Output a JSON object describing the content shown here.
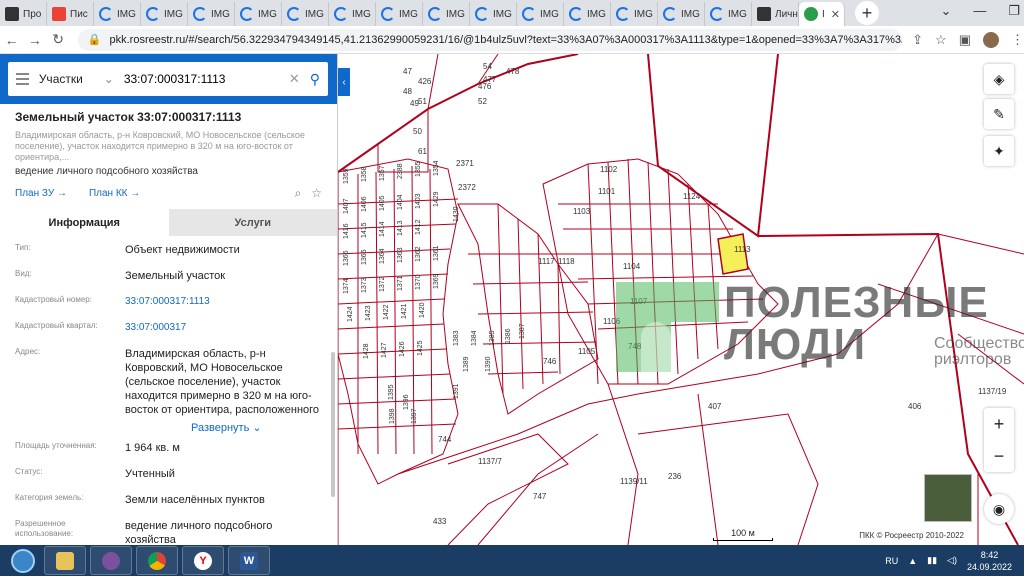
{
  "browser": {
    "tabs": [
      {
        "label": "Про",
        "icon": "page-icon"
      },
      {
        "label": "Пис",
        "icon": "gmail-icon"
      },
      {
        "label": "IMG",
        "icon": "img-icon"
      },
      {
        "label": "IMG",
        "icon": "img-icon"
      },
      {
        "label": "IMG",
        "icon": "img-icon"
      },
      {
        "label": "IMG",
        "icon": "img-icon"
      },
      {
        "label": "IMG",
        "icon": "img-icon"
      },
      {
        "label": "IMG",
        "icon": "img-icon"
      },
      {
        "label": "IMG",
        "icon": "img-icon"
      },
      {
        "label": "IMG",
        "icon": "img-icon"
      },
      {
        "label": "IMG",
        "icon": "img-icon"
      },
      {
        "label": "IMG",
        "icon": "img-icon"
      },
      {
        "label": "IMG",
        "icon": "img-icon"
      },
      {
        "label": "IMG",
        "icon": "img-icon"
      },
      {
        "label": "IMG",
        "icon": "img-icon"
      },
      {
        "label": "IMG",
        "icon": "img-icon"
      },
      {
        "label": "Личн",
        "icon": "page-icon"
      },
      {
        "label": "I",
        "icon": "rosreestr-icon",
        "active": true
      }
    ],
    "new_tab": "+",
    "url": "pkk.rosreestr.ru/#/search/56.322934794349145,41.21362990059231/16/@1b4ulz5uvl?text=33%3A07%3A000317%3A1113&type=1&opened=33%3A7%3A317%3A1113"
  },
  "search": {
    "type_label": "Участки",
    "query": "33:07:000317:1113"
  },
  "object": {
    "title": "Земельный участок 33:07:000317:1113",
    "address_short": "Владимирская область, р-н Ковровский, МО Новосельское (сельское поселение), участок находится примерно в 320 м на юго-восток от ориентира,...",
    "use": "ведение личного подсобного хозяйства",
    "plan_zu": "План ЗУ →",
    "plan_kk": "План КК →"
  },
  "panel_tabs": {
    "info": "Информация",
    "services": "Услуги"
  },
  "info_rows": [
    {
      "label": "Тип:",
      "value": "Объект недвижимости"
    },
    {
      "label": "Вид:",
      "value": "Земельный участок"
    },
    {
      "label": "Кадастровый номер:",
      "value": "33:07:000317:1113",
      "link": true
    },
    {
      "label": "Кадастровый квартал:",
      "value": "33:07:000317",
      "link": true
    },
    {
      "label": "Адрес:",
      "value": "Владимирская область, р-н Ковровский, МО Новосельское (сельское поселение), участок находится примерно в 320 м на юго-восток от ориентира, расположенного"
    },
    {
      "label": "Площадь уточненная:",
      "value": "1 964 кв. м"
    },
    {
      "label": "Статус:",
      "value": "Учтенный"
    },
    {
      "label": "Категория земель:",
      "value": "Земли населённых пунктов"
    },
    {
      "label": "Разрешенное использование:",
      "value": "ведение личного подсобного хозяйства"
    }
  ],
  "expand_label": "Развернуть ⌄",
  "map": {
    "parcels": [
      "426",
      "47",
      "48",
      "49",
      "50",
      "51",
      "52",
      "54",
      "476",
      "477",
      "478",
      "61",
      "2371",
      "2372",
      "1359",
      "1358",
      "1357",
      "2388",
      "1355",
      "1354",
      "1407",
      "1406",
      "1405",
      "1404",
      "1403",
      "1429",
      "1430",
      "1416",
      "1415",
      "1414",
      "1413",
      "1412",
      "1366",
      "1365",
      "1364",
      "1363",
      "1362",
      "1361",
      "1374",
      "1373",
      "1372",
      "1371",
      "1370",
      "1369",
      "1424",
      "1423",
      "1422",
      "1421",
      "1420",
      "1383",
      "1384",
      "1385",
      "1386",
      "1387",
      "1428",
      "1427",
      "1426",
      "1425",
      "1389",
      "1390",
      "1395",
      "1396",
      "1391",
      "1397",
      "1398",
      "1101",
      "1102",
      "1103",
      "1117",
      "1118",
      "1124",
      "1113",
      "1104",
      "1105",
      "1106",
      "1107",
      "746",
      "748",
      "744",
      "747",
      "433",
      "236",
      "407",
      "406",
      "1137/19",
      "1137/7",
      "1139/11"
    ],
    "highlight_parcel": "1113",
    "scale": "100 м",
    "copyright": "ПКК © Росреестр 2010-2022",
    "accent_color": "#b0001e",
    "highlight_color": "#f5f05a"
  },
  "watermark": {
    "line1": "ПОЛЕЗНЫЕ",
    "line2": "ЛЮДИ",
    "line3": "Сообщество\nриэлторов"
  },
  "taskbar": {
    "apps": [
      "explorer",
      "viber",
      "chrome",
      "yandex",
      "word"
    ],
    "lang": "RU",
    "time": "8:42",
    "date": "24.09.2022"
  }
}
